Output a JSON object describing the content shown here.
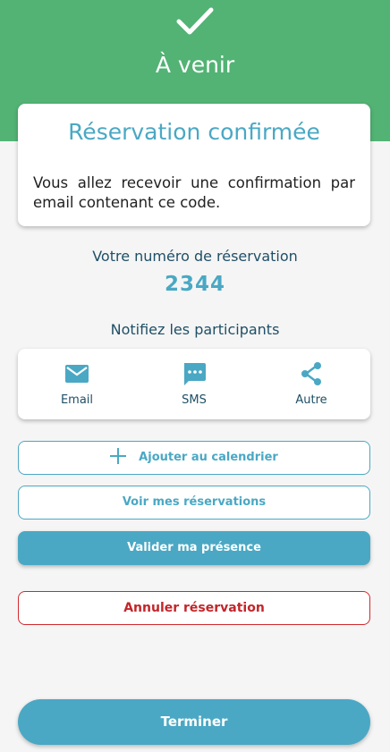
{
  "header": {
    "title": "À venir",
    "icon": "check-icon",
    "background_color": "#52b374"
  },
  "confirmation": {
    "title": "Réservation confirmée",
    "message": "Vous allez recevoir une confirmation par email contenant ce code."
  },
  "booking": {
    "label": "Votre numéro de réservation",
    "number": "2344"
  },
  "notify": {
    "label": "Notifiez les participants",
    "options": [
      {
        "label": "Email",
        "icon": "email-icon"
      },
      {
        "label": "SMS",
        "icon": "sms-icon"
      },
      {
        "label": "Autre",
        "icon": "share-icon"
      }
    ]
  },
  "actions": {
    "add_calendar": "Ajouter au calendrier",
    "view_reservations": "Voir mes réservations",
    "validate_presence": "Valider ma présence",
    "cancel_reservation": "Annuler réservation",
    "finish": "Terminer"
  },
  "colors": {
    "accent": "#4aa8c4",
    "danger": "#c2262a",
    "success": "#52b374",
    "text_dark": "#1f4f66"
  }
}
